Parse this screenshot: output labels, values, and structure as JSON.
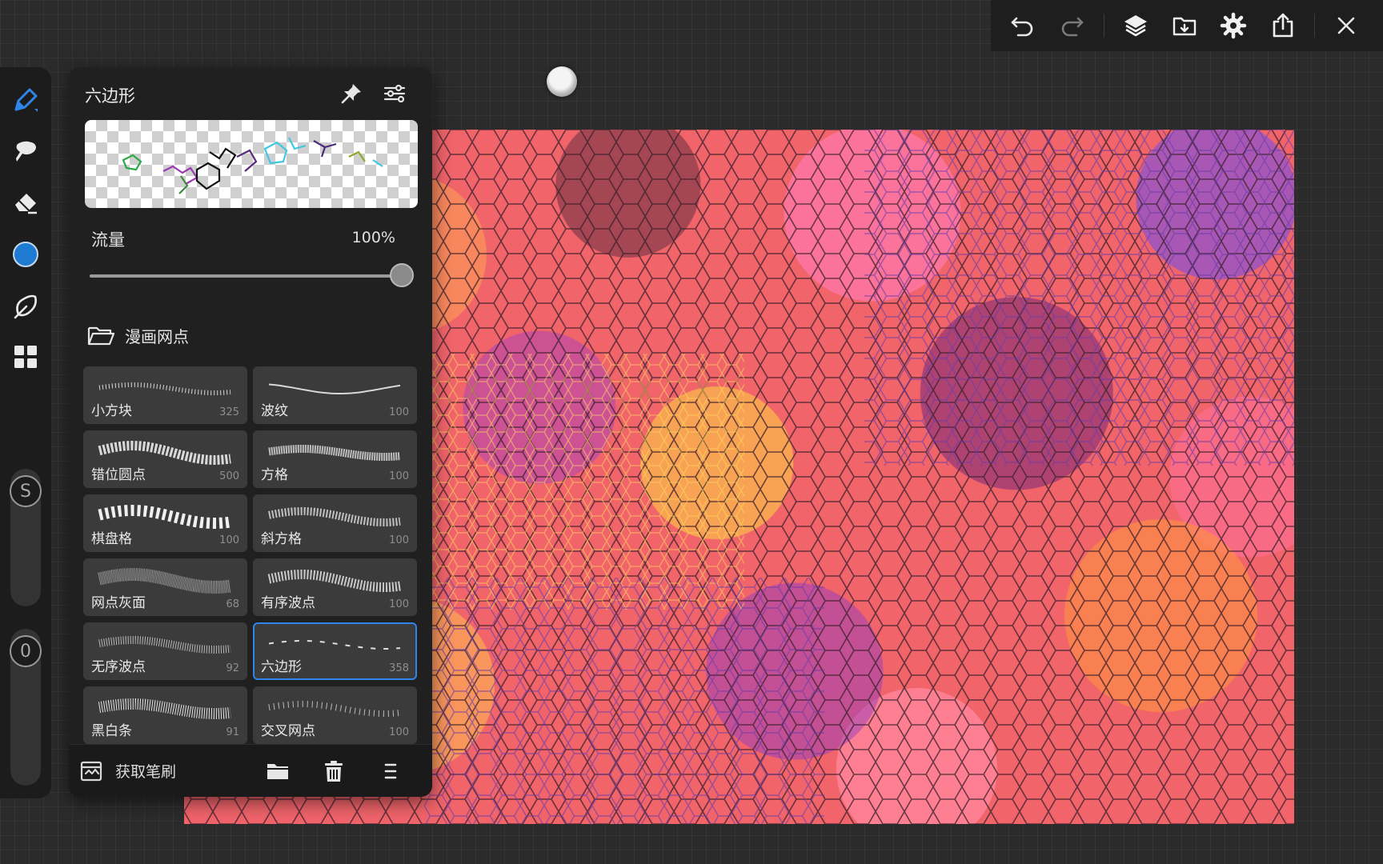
{
  "app": {
    "accent_color": "#2e86e8",
    "canvas_base_color": "#f0646a"
  },
  "topbar": {
    "buttons": [
      {
        "name": "undo-icon"
      },
      {
        "name": "redo-icon"
      },
      {
        "name": "layers-icon"
      },
      {
        "name": "gallery-import-icon"
      },
      {
        "name": "settings-gear-icon"
      },
      {
        "name": "share-export-icon"
      },
      {
        "name": "close-icon"
      }
    ]
  },
  "rail": {
    "tools": [
      "brush-tool-icon",
      "smudge-tool-icon",
      "eraser-tool-icon",
      "color-picker",
      "selection-lasso-icon",
      "apps-grid-icon"
    ],
    "current_color": "#1e7bd1",
    "size_slider_label": "S",
    "opacity_slider_label": "0"
  },
  "panel": {
    "title": "六边形",
    "flow": {
      "label": "流量",
      "value_text": "100%",
      "value": 1.0
    },
    "brush_set": {
      "name": "漫画网点"
    },
    "brushes": [
      {
        "name": "小方块",
        "count": "325",
        "pattern": "dots-fine"
      },
      {
        "name": "波纹",
        "count": "100",
        "pattern": "waves"
      },
      {
        "name": "错位圆点",
        "count": "500",
        "pattern": "dots-wave"
      },
      {
        "name": "方格",
        "count": "100",
        "pattern": "grid-wave"
      },
      {
        "name": "棋盘格",
        "count": "100",
        "pattern": "checker-wave"
      },
      {
        "name": "斜方格",
        "count": "100",
        "pattern": "diamond-wave"
      },
      {
        "name": "网点灰面",
        "count": "68",
        "pattern": "gray-wave"
      },
      {
        "name": "有序波点",
        "count": "100",
        "pattern": "ordered-dots"
      },
      {
        "name": "无序波点",
        "count": "92",
        "pattern": "random-dots"
      },
      {
        "name": "六边形",
        "count": "358",
        "pattern": "hexagon",
        "selected": true
      },
      {
        "name": "黑白条",
        "count": "91",
        "pattern": "stripes"
      },
      {
        "name": "交叉网点",
        "count": "100",
        "pattern": "cross-dots"
      }
    ],
    "footer": {
      "fetch_label": "获取笔刷"
    }
  }
}
